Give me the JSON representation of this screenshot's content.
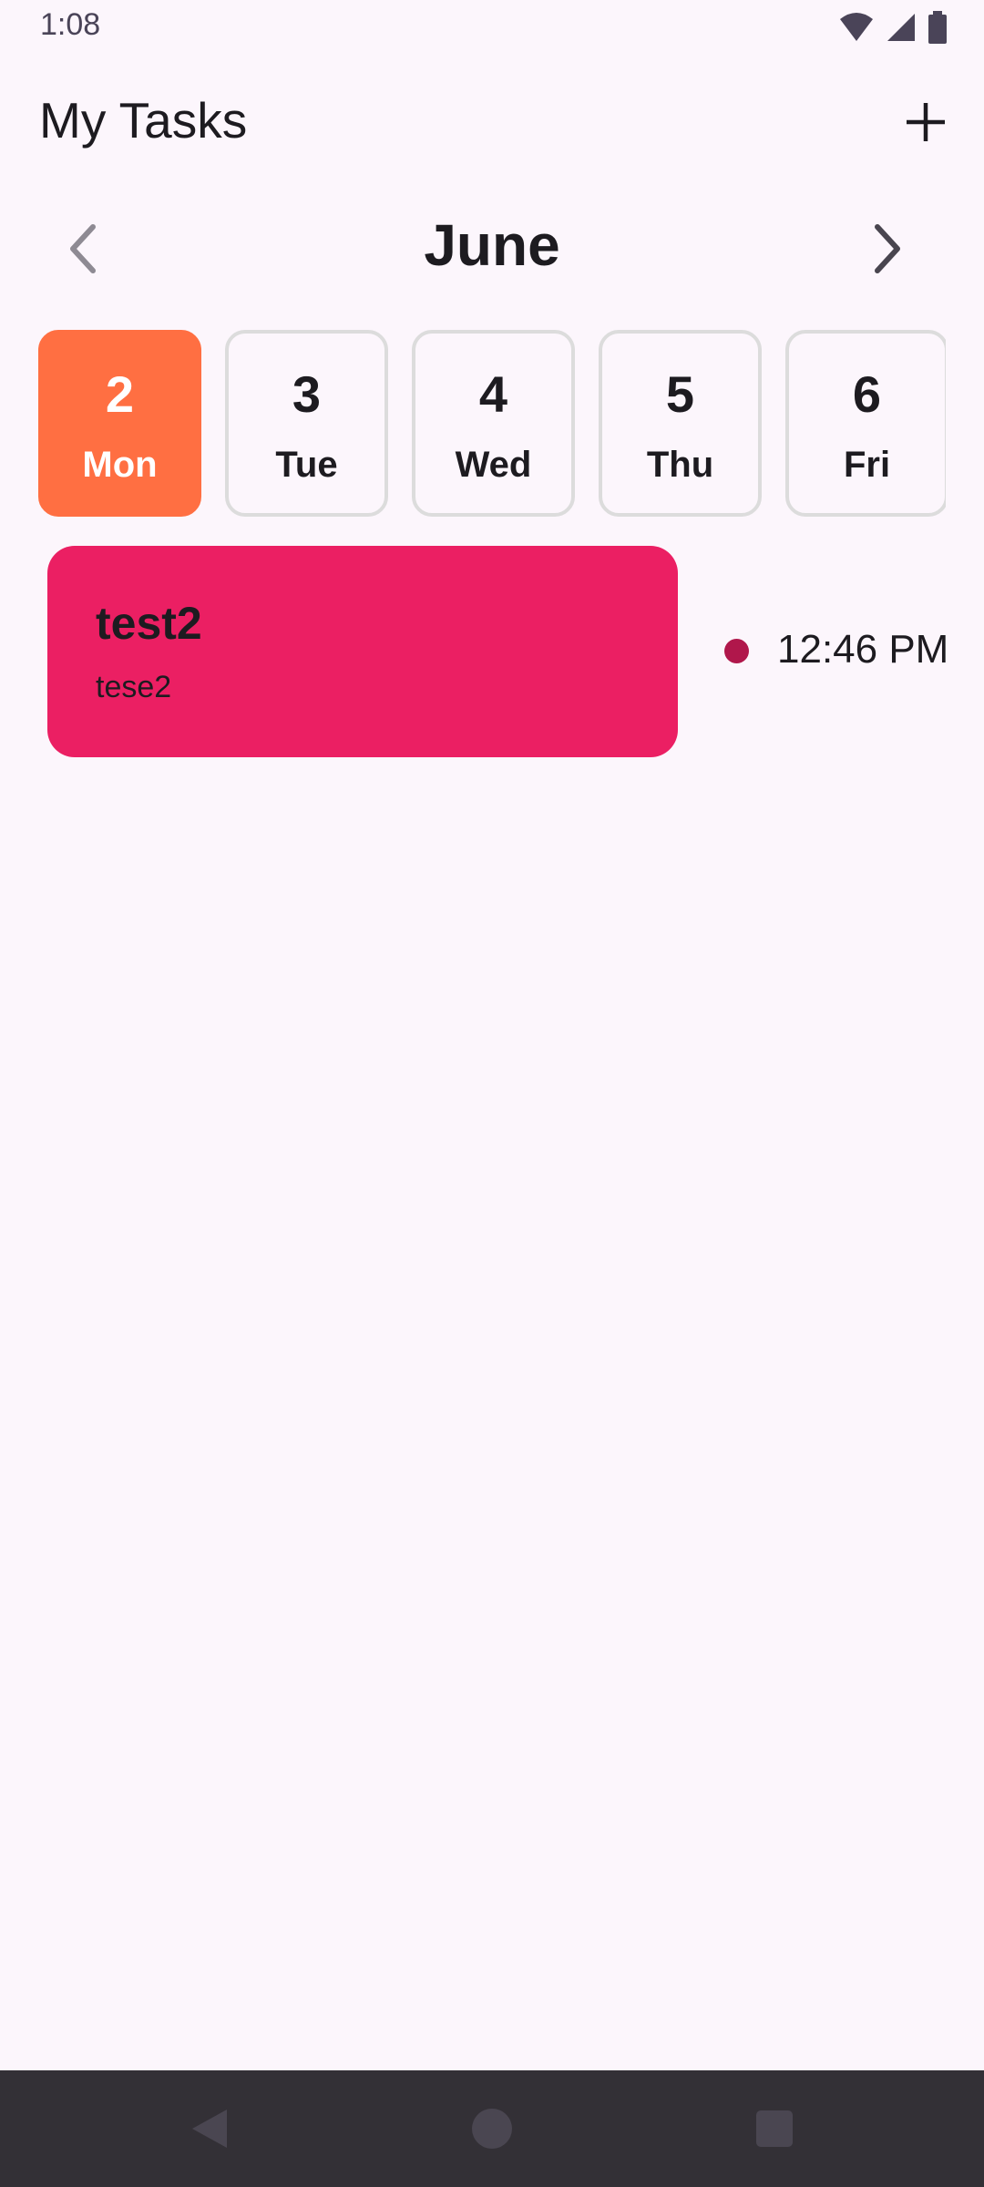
{
  "status_bar": {
    "time": "1:08",
    "icons": [
      "wifi-icon",
      "signal-icon",
      "battery-icon"
    ]
  },
  "header": {
    "title": "My Tasks",
    "add_icon": "plus-icon"
  },
  "month_nav": {
    "month": "June",
    "prev_icon": "chevron-left-icon",
    "next_icon": "chevron-right-icon"
  },
  "days": [
    {
      "num": "2",
      "name": "Mon",
      "selected": true
    },
    {
      "num": "3",
      "name": "Tue",
      "selected": false
    },
    {
      "num": "4",
      "name": "Wed",
      "selected": false
    },
    {
      "num": "5",
      "name": "Thu",
      "selected": false
    },
    {
      "num": "6",
      "name": "Fri",
      "selected": false
    }
  ],
  "tasks": [
    {
      "title": "test2",
      "description": "tese2",
      "time": "12:46 PM",
      "color": "#EB1F63",
      "dot_color": "#B0174B"
    }
  ],
  "colors": {
    "background": "#FCF6FC",
    "selected_day": "#FF6F42",
    "nav_bar": "#333036"
  },
  "nav_bar": {
    "icons": [
      "back-icon",
      "home-icon",
      "recents-icon"
    ]
  }
}
